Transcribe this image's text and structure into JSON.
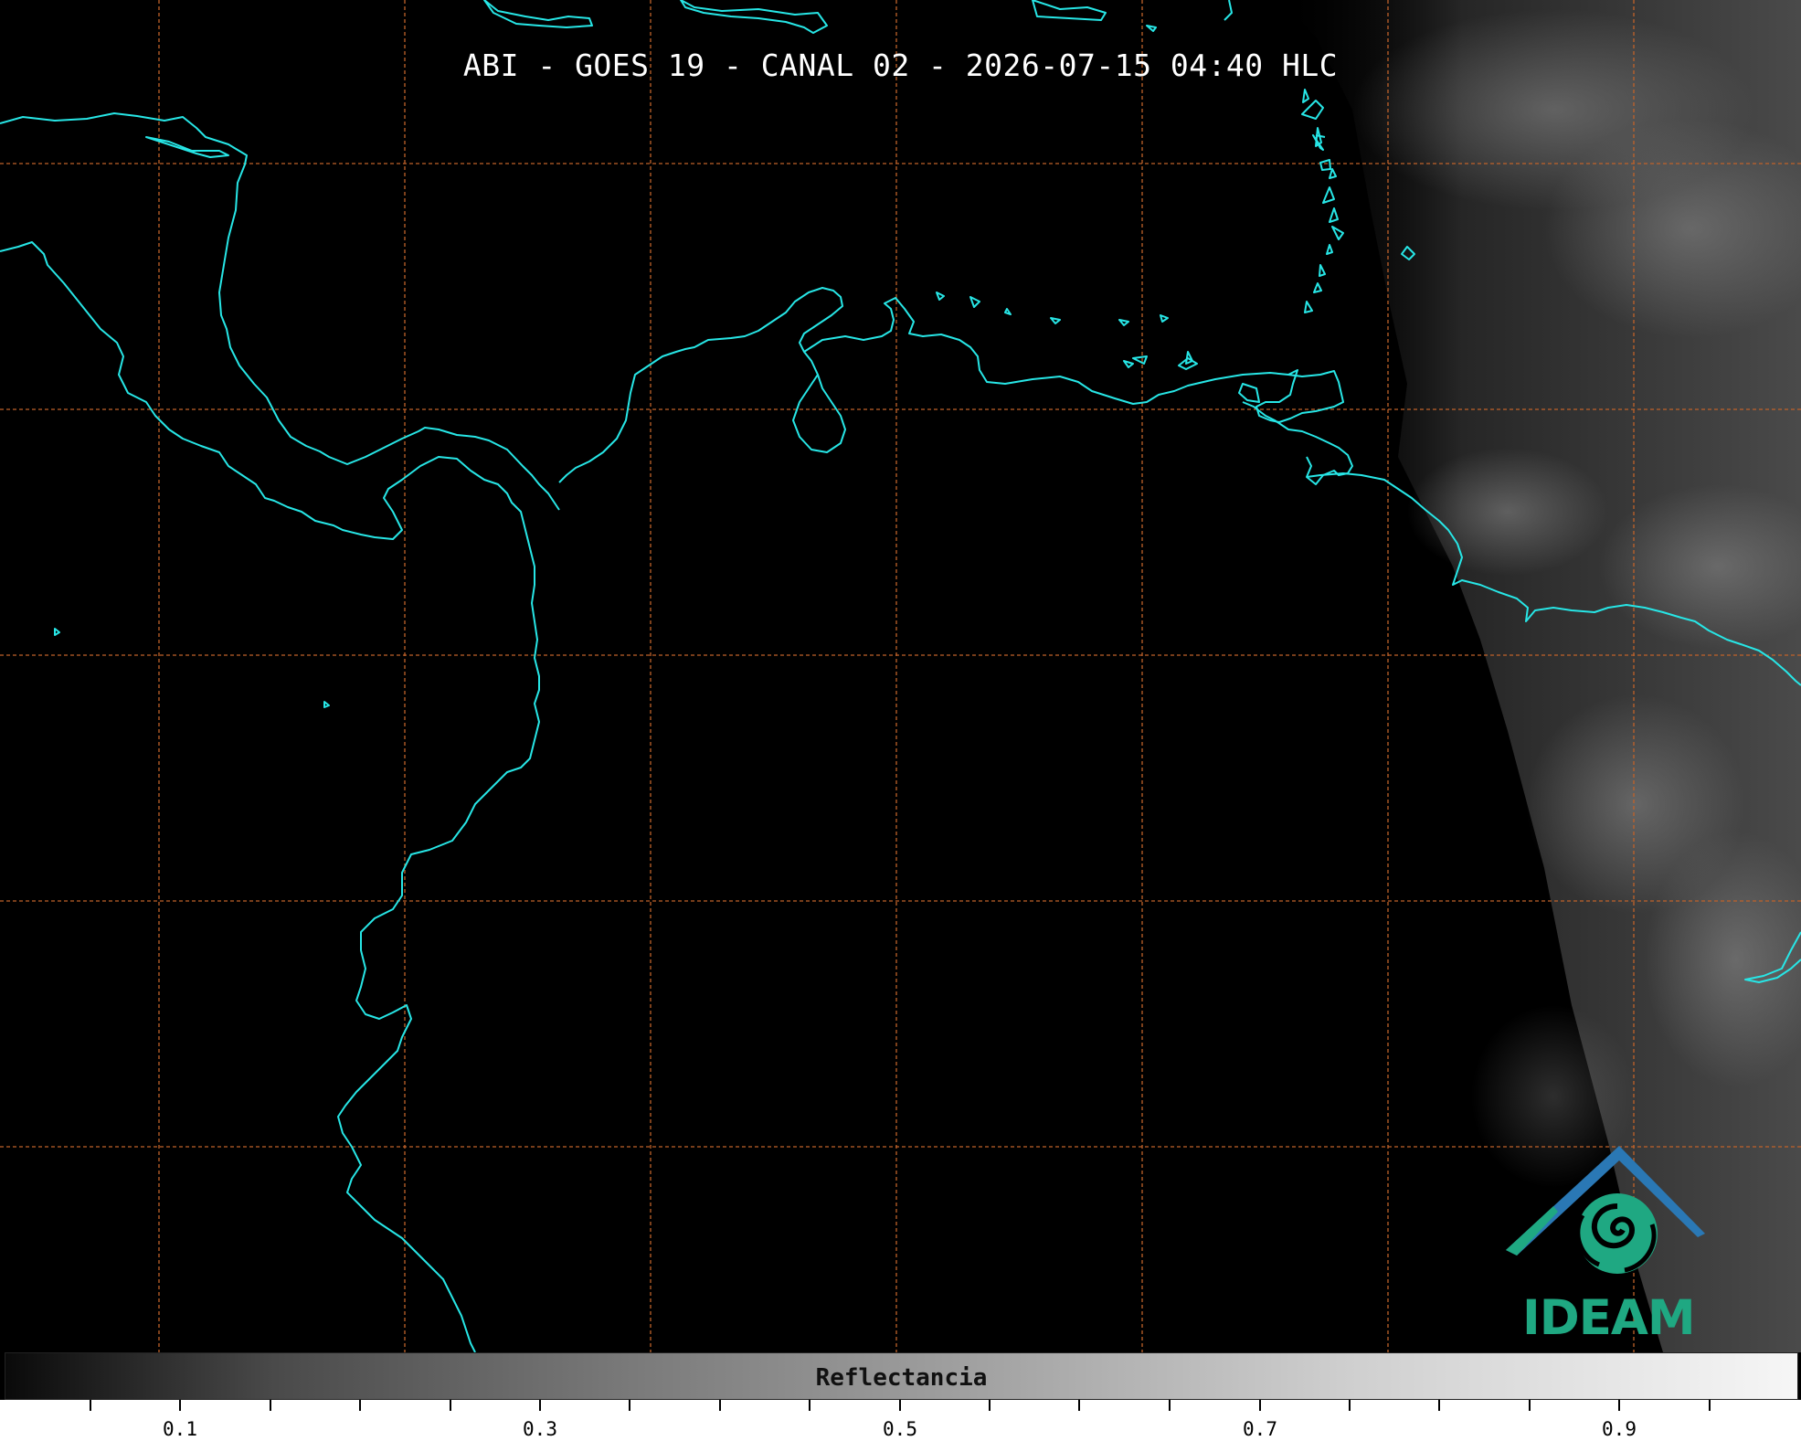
{
  "title": "ABI - GOES 19 - CANAL 02 - 2026-07-15 04:40 HLC",
  "colorbar": {
    "label": "Reflectancia",
    "ticks": [
      "0.1",
      "0.3",
      "0.5",
      "0.7",
      "0.9"
    ]
  },
  "logo": {
    "text": "IDEAM"
  },
  "colors": {
    "coastline": "#27e6e6",
    "gridline": "#c0622a",
    "background": "#000000",
    "logo_green": "#1fa882",
    "logo_blue": "#2a78b5"
  }
}
